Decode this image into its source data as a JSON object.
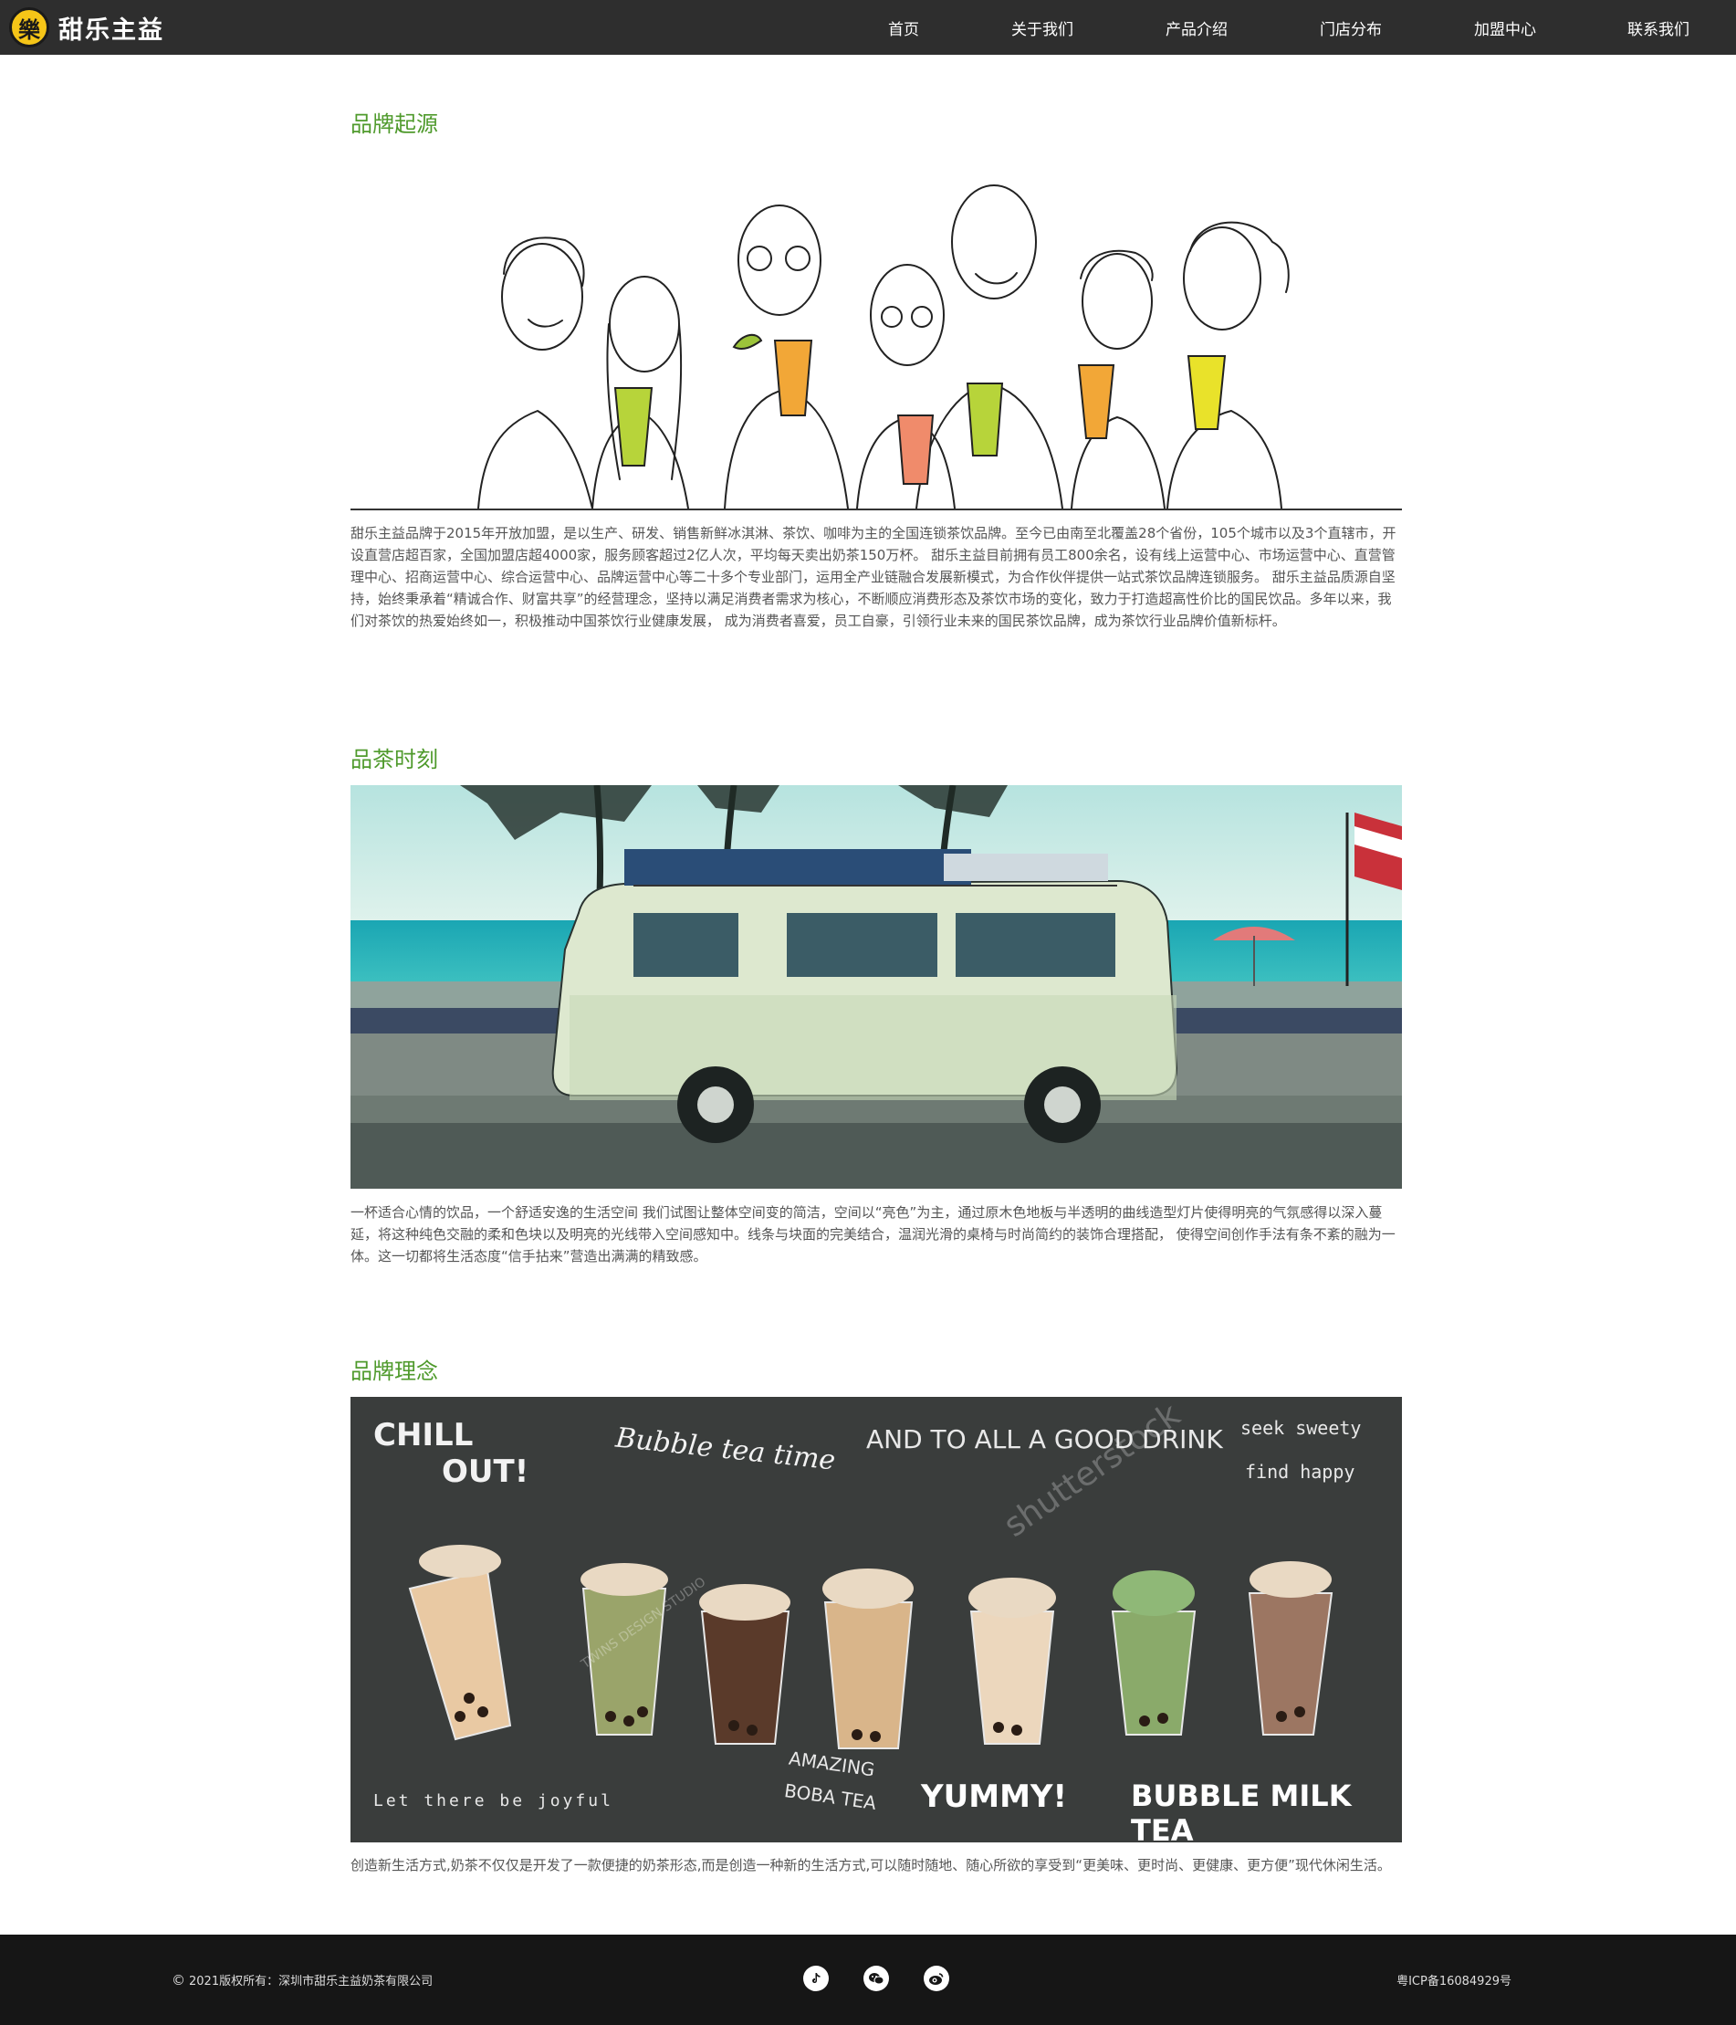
{
  "header": {
    "logo_glyph": "樂",
    "logo_text": "甜乐主益",
    "nav": [
      "首页",
      "关于我们",
      "产品介绍",
      "门店分布",
      "加盟中心",
      "联系我们"
    ]
  },
  "sections": [
    {
      "title": "品牌起源",
      "text": "甜乐主益品牌于2015年开放加盟，是以生产、研发、销售新鲜冰淇淋、茶饮、咖啡为主的全国连锁茶饮品牌。至今已由南至北覆盖28个省份，105个城市以及3个直辖市，开设直营店超百家，全国加盟店超4000家，服务顾客超过2亿人次，平均每天卖出奶茶150万杯。 甜乐主益目前拥有员工800余名，设有线上运营中心、市场运营中心、直营管理中心、招商运营中心、综合运营中心、品牌运营中心等二十多个专业部门，运用全产业链融合发展新模式，为合作伙伴提供一站式茶饮品牌连锁服务。 甜乐主益品质源自坚持，始终秉承着“精诚合作、财富共享”的经营理念，坚持以满足消费者需求为核心，不断顺应消费形态及茶饮市场的变化，致力于打造超高性价比的国民饮品。多年以来，我们对茶饮的热爱始终如一，积极推动中国茶饮行业健康发展， 成为消费者喜爱，员工自豪，引领行业未来的国民茶饮品牌，成为茶饮行业品牌价值新标杆。"
    },
    {
      "title": "品茶时刻",
      "text": "一杯适合心情的饮品，一个舒适安逸的生活空间 我们试图让整体空间变的简洁，空间以“亮色”为主，通过原木色地板与半透明的曲线造型灯片使得明亮的气氛感得以深入蔓延，将这种纯色交融的柔和色块以及明亮的光线带入空间感知中。线条与块面的完美结合，温润光滑的桌椅与时尚简约的装饰合理搭配， 使得空间创作手法有条不紊的融为一体。这一切都将生活态度“信手拈来”营造出满满的精致感。"
    },
    {
      "title": "品牌理念",
      "text": "创造新生活方式,奶茶不仅仅是开发了一款便捷的奶茶形态,而是创造一种新的生活方式,可以随时随地、随心所欲的享受到“更美味、更时尚、更健康、更方便”现代休闲生活。"
    }
  ],
  "chalkboard": {
    "texts": [
      "CHILL",
      "OUT!",
      "Bubble tea time",
      "AND TO ALL A GOOD DRINK",
      "seek sweety",
      "find happy",
      "Let there be joyful",
      "AMAZING",
      "BOBA TEA",
      "YUMMY!",
      "BUBBLE MILK TEA",
      "shutterstock",
      "TWINS DESIGN STUDIO"
    ]
  },
  "footer": {
    "copyright": "2021版权所有：深圳市甜乐主益奶茶有限公司",
    "copyright_symbol": "©",
    "icp": "粤ICP备16084929号",
    "social": [
      "tiktok-icon",
      "wechat-icon",
      "weibo-icon"
    ]
  },
  "colors": {
    "header_bg": "#2e2e2e",
    "accent_green": "#4f9a2c",
    "logo_yellow": "#f5c518",
    "footer_bg": "#161616",
    "chalkboard": "#3a3d3c"
  }
}
